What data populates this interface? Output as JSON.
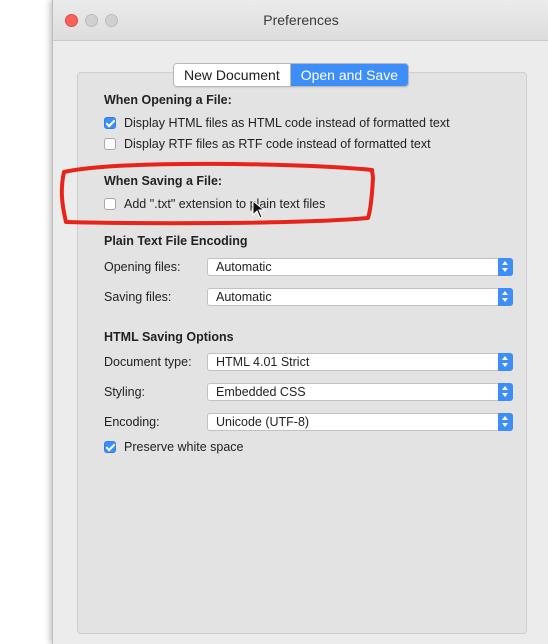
{
  "window": {
    "title": "Preferences"
  },
  "tabs": [
    {
      "label": "New Document"
    },
    {
      "label": "Open and Save",
      "active": true
    }
  ],
  "opening": {
    "title": "When Opening a File:",
    "options": [
      {
        "label": "Display HTML files as HTML code instead of formatted text",
        "checked": true
      },
      {
        "label": "Display RTF files as RTF code instead of formatted text",
        "checked": false
      }
    ]
  },
  "saving": {
    "title": "When Saving a File:",
    "options": [
      {
        "label": "Add \".txt\" extension to plain text files",
        "checked": false
      }
    ]
  },
  "encoding": {
    "title": "Plain Text File Encoding",
    "opening_label": "Opening files:",
    "opening_value": "Automatic",
    "saving_label": "Saving files:",
    "saving_value": "Automatic"
  },
  "html_saving": {
    "title": "HTML Saving Options",
    "doctype_label": "Document type:",
    "doctype_value": "HTML 4.01 Strict",
    "styling_label": "Styling:",
    "styling_value": "Embedded CSS",
    "encoding_label": "Encoding:",
    "encoding_value": "Unicode (UTF-8)",
    "preserve_label": "Preserve white space",
    "preserve_checked": true
  },
  "colors": {
    "accent": "#3d8ef8",
    "annotation": "#e8231a"
  }
}
